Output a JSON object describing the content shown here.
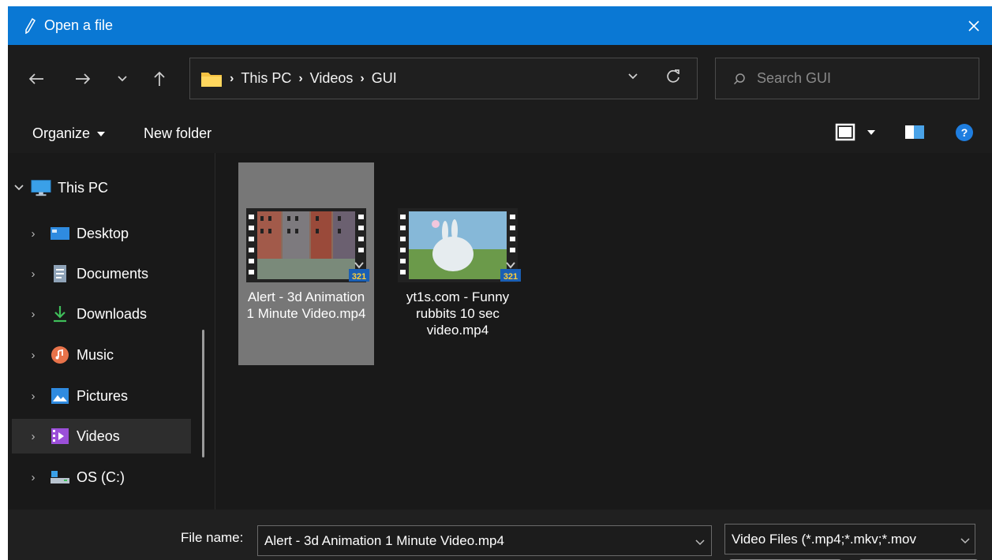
{
  "window": {
    "title": "Open a file"
  },
  "address_bar": {
    "crumbs": [
      "This PC",
      "Videos",
      "GUI"
    ]
  },
  "search": {
    "placeholder": "Search GUI"
  },
  "toolbar": {
    "organize_label": "Organize",
    "new_folder_label": "New folder"
  },
  "sidebar": {
    "items": [
      {
        "label": "This PC",
        "icon": "monitor-icon",
        "expanded": true
      },
      {
        "label": "Desktop",
        "icon": "desktop-icon"
      },
      {
        "label": "Documents",
        "icon": "documents-icon"
      },
      {
        "label": "Downloads",
        "icon": "download-icon"
      },
      {
        "label": "Music",
        "icon": "music-icon"
      },
      {
        "label": "Pictures",
        "icon": "pictures-icon"
      },
      {
        "label": "Videos",
        "icon": "videos-icon",
        "selected": true
      },
      {
        "label": "OS (C:)",
        "icon": "drive-icon"
      }
    ]
  },
  "files": [
    {
      "name": "Alert - 3d Animation 1 Minute Video.mp4",
      "selected": true
    },
    {
      "name": "yt1s.com - Funny rubbits 10 sec video.mp4",
      "selected": false
    }
  ],
  "bottom": {
    "file_name_label": "File name:",
    "file_name_value": "Alert - 3d Animation 1 Minute Video.mp4",
    "file_type_value": "Video Files (*.mp4;*.mkv;*.mov"
  },
  "colors": {
    "title_bar": "#0a78d4",
    "background": "#191919",
    "selection": "#777777"
  }
}
